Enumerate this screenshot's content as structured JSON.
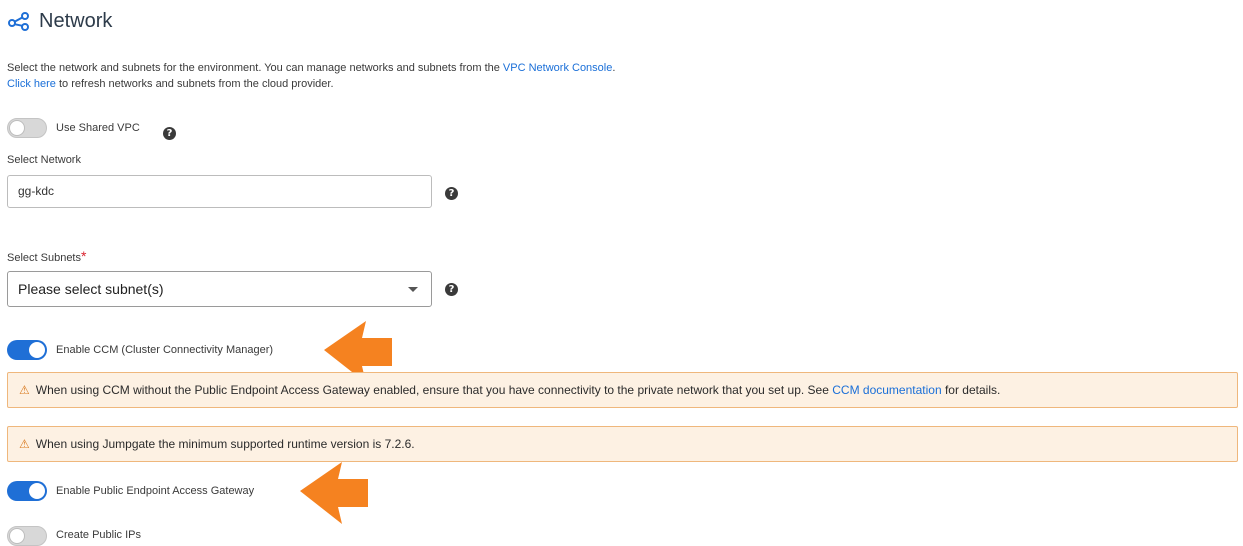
{
  "header": {
    "title": "Network",
    "icon": "share-network-icon"
  },
  "description": {
    "line1_text": "Select the network and subnets for the environment. You can manage networks and subnets from the",
    "line1_link": "VPC Network Console",
    "line1_end": ".",
    "line2_link": "Click here",
    "line2_text": "to refresh networks and subnets from the cloud provider."
  },
  "shared_vpc": {
    "label": "Use Shared VPC",
    "enabled": false
  },
  "network": {
    "label": "Select Network",
    "value": "gg-kdc"
  },
  "subnets": {
    "label": "Select Subnets",
    "required_mark": "*",
    "placeholder": "Please select subnet(s)"
  },
  "help_glyph": "?",
  "ccm": {
    "label": "Enable CCM (Cluster Connectivity Manager)",
    "enabled": true
  },
  "alerts": {
    "ccm": {
      "icon": "warning-icon",
      "text": "When using CCM without the Public Endpoint Access Gateway enabled, ensure that you have connectivity to the private network that you set up. See",
      "link": "CCM documentation",
      "text_end": "for details."
    },
    "jumpgate": {
      "icon": "warning-icon",
      "text": "When using Jumpgate the minimum supported runtime version is 7.2.6."
    }
  },
  "public_endpoint": {
    "label": "Enable Public Endpoint Access Gateway",
    "enabled": true
  },
  "public_ips": {
    "label": "Create Public IPs",
    "enabled": false
  },
  "colors": {
    "accent": "#1f6fd6",
    "link": "#1a6fd8",
    "warning_bg": "#fdf1e3",
    "warning_border": "#efb77c",
    "annotation_arrow": "#f58220"
  }
}
